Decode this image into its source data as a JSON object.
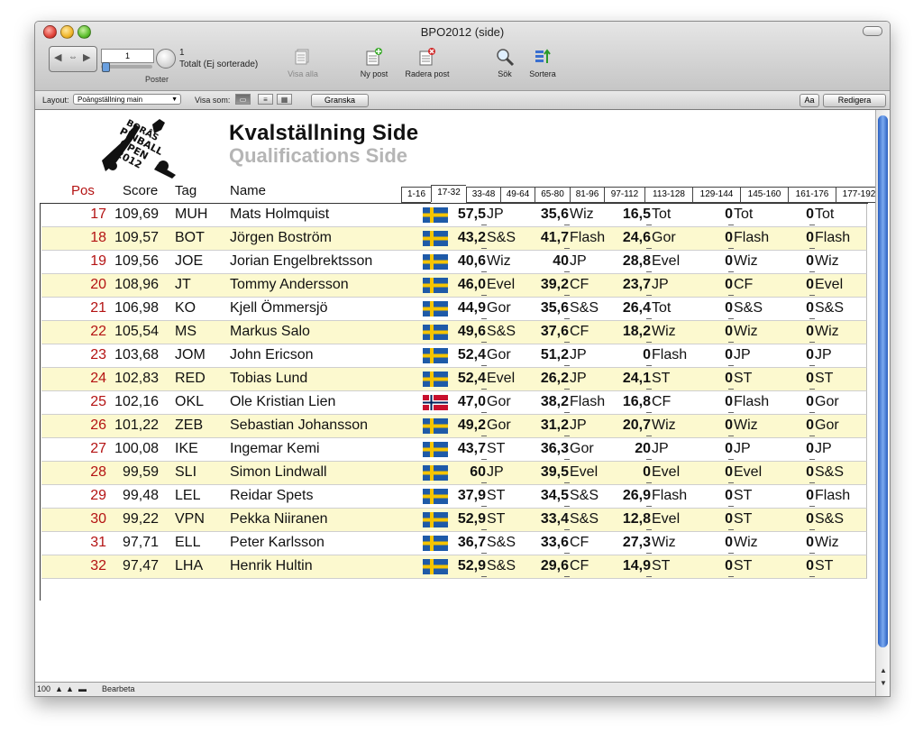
{
  "window": {
    "title": "BPO2012 (side)"
  },
  "toolbar": {
    "record_value": "1",
    "total_count": "1",
    "total_label": "Totalt (Ej sorterade)",
    "poster_label": "Poster",
    "show_all": "Visa alla",
    "new_record": "Ny post",
    "delete_record": "Radera post",
    "search": "Sök",
    "sort": "Sortera"
  },
  "layoutbar": {
    "layout_label": "Layout:",
    "layout_value": "Poängställning main",
    "view_as_label": "Visa som:",
    "preview": "Granska",
    "aa": "Aa",
    "edit": "Redigera"
  },
  "header": {
    "title": "Kvalställning Side",
    "subtitle": "Qualifications Side",
    "col_pos": "Pos",
    "col_score": "Score",
    "col_tag": "Tag",
    "col_name": "Name"
  },
  "ranges": [
    "1-16",
    "17-32",
    "33-48",
    "49-64",
    "65-80",
    "81-96",
    "97-112",
    "113-128",
    "129-144",
    "145-160",
    "161-176",
    "177-192"
  ],
  "active_range": "17-32",
  "rows": [
    {
      "pos": "17",
      "score": "109,69",
      "tag": "MUH",
      "name": "Mats Holmquist",
      "flag": "se",
      "v1": "57,5",
      "c1": "JP",
      "v2": "35,6",
      "c2": "Wiz",
      "v3": "16,5",
      "c3": "Tot",
      "v4": "0",
      "c4": "Tot",
      "v5": "0",
      "c5": "Tot"
    },
    {
      "pos": "18",
      "score": "109,57",
      "tag": "BOT",
      "name": "Jörgen Boström",
      "flag": "se",
      "v1": "43,2",
      "c1": "S&S",
      "v2": "41,7",
      "c2": "Flash",
      "v3": "24,6",
      "c3": "Gor",
      "v4": "0",
      "c4": "Flash",
      "v5": "0",
      "c5": "Flash"
    },
    {
      "pos": "19",
      "score": "109,56",
      "tag": "JOE",
      "name": "Jorian Engelbrektsson",
      "flag": "se",
      "v1": "40,6",
      "c1": "Wiz",
      "v2": "40",
      "c2": "JP",
      "v3": "28,8",
      "c3": "Evel",
      "v4": "0",
      "c4": "Wiz",
      "v5": "0",
      "c5": "Wiz"
    },
    {
      "pos": "20",
      "score": "108,96",
      "tag": "JT",
      "name": "Tommy Andersson",
      "flag": "se",
      "v1": "46,0",
      "c1": "Evel",
      "v2": "39,2",
      "c2": "CF",
      "v3": "23,7",
      "c3": "JP",
      "v4": "0",
      "c4": "CF",
      "v5": "0",
      "c5": "Evel"
    },
    {
      "pos": "21",
      "score": "106,98",
      "tag": "KO",
      "name": "Kjell Ömmersjö",
      "flag": "se",
      "v1": "44,9",
      "c1": "Gor",
      "v2": "35,6",
      "c2": "S&S",
      "v3": "26,4",
      "c3": "Tot",
      "v4": "0",
      "c4": "S&S",
      "v5": "0",
      "c5": "S&S"
    },
    {
      "pos": "22",
      "score": "105,54",
      "tag": "MS",
      "name": "Markus Salo",
      "flag": "se",
      "v1": "49,6",
      "c1": "S&S",
      "v2": "37,6",
      "c2": "CF",
      "v3": "18,2",
      "c3": "Wiz",
      "v4": "0",
      "c4": "Wiz",
      "v5": "0",
      "c5": "Wiz"
    },
    {
      "pos": "23",
      "score": "103,68",
      "tag": "JOM",
      "name": "John Ericson",
      "flag": "se",
      "v1": "52,4",
      "c1": "Gor",
      "v2": "51,2",
      "c2": "JP",
      "v3": "0",
      "c3": "Flash",
      "v4": "0",
      "c4": "JP",
      "v5": "0",
      "c5": "JP"
    },
    {
      "pos": "24",
      "score": "102,83",
      "tag": "RED",
      "name": "Tobias Lund",
      "flag": "se",
      "v1": "52,4",
      "c1": "Evel",
      "v2": "26,2",
      "c2": "JP",
      "v3": "24,1",
      "c3": "ST",
      "v4": "0",
      "c4": "ST",
      "v5": "0",
      "c5": "ST"
    },
    {
      "pos": "25",
      "score": "102,16",
      "tag": "OKL",
      "name": "Ole Kristian Lien",
      "flag": "no",
      "v1": "47,0",
      "c1": "Gor",
      "v2": "38,2",
      "c2": "Flash",
      "v3": "16,8",
      "c3": "CF",
      "v4": "0",
      "c4": "Flash",
      "v5": "0",
      "c5": "Gor"
    },
    {
      "pos": "26",
      "score": "101,22",
      "tag": "ZEB",
      "name": "Sebastian Johansson",
      "flag": "se",
      "v1": "49,2",
      "c1": "Gor",
      "v2": "31,2",
      "c2": "JP",
      "v3": "20,7",
      "c3": "Wiz",
      "v4": "0",
      "c4": "Wiz",
      "v5": "0",
      "c5": "Gor"
    },
    {
      "pos": "27",
      "score": "100,08",
      "tag": "IKE",
      "name": "Ingemar Kemi",
      "flag": "se",
      "v1": "43,7",
      "c1": "ST",
      "v2": "36,3",
      "c2": "Gor",
      "v3": "20",
      "c3": "JP",
      "v4": "0",
      "c4": "JP",
      "v5": "0",
      "c5": "JP"
    },
    {
      "pos": "28",
      "score": "99,59",
      "tag": "SLI",
      "name": "Simon Lindwall",
      "flag": "se",
      "v1": "60",
      "c1": "JP",
      "v2": "39,5",
      "c2": "Evel",
      "v3": "0",
      "c3": "Evel",
      "v4": "0",
      "c4": "Evel",
      "v5": "0",
      "c5": "S&S"
    },
    {
      "pos": "29",
      "score": "99,48",
      "tag": "LEL",
      "name": "Reidar Spets",
      "flag": "se",
      "v1": "37,9",
      "c1": "ST",
      "v2": "34,5",
      "c2": "S&S",
      "v3": "26,9",
      "c3": "Flash",
      "v4": "0",
      "c4": "ST",
      "v5": "0",
      "c5": "Flash"
    },
    {
      "pos": "30",
      "score": "99,22",
      "tag": "VPN",
      "name": "Pekka Niiranen",
      "flag": "se",
      "v1": "52,9",
      "c1": "ST",
      "v2": "33,4",
      "c2": "S&S",
      "v3": "12,8",
      "c3": "Evel",
      "v4": "0",
      "c4": "ST",
      "v5": "0",
      "c5": "S&S"
    },
    {
      "pos": "31",
      "score": "97,71",
      "tag": "ELL",
      "name": "Peter Karlsson",
      "flag": "se",
      "v1": "36,7",
      "c1": "S&S",
      "v2": "33,6",
      "c2": "CF",
      "v3": "27,3",
      "c3": "Wiz",
      "v4": "0",
      "c4": "Wiz",
      "v5": "0",
      "c5": "Wiz"
    },
    {
      "pos": "32",
      "score": "97,47",
      "tag": "LHA",
      "name": "Henrik Hultin",
      "flag": "se",
      "v1": "52,9",
      "c1": "S&S",
      "v2": "29,6",
      "c2": "CF",
      "v3": "14,9",
      "c3": "ST",
      "v4": "0",
      "c4": "ST",
      "v5": "0",
      "c5": "ST"
    }
  ],
  "status": {
    "zoom": "100",
    "mode": "Bearbeta"
  },
  "colors": {
    "pos": "#b41313",
    "alt_row": "#fcf9cf",
    "scroll_thumb": "#3a6fd0"
  }
}
